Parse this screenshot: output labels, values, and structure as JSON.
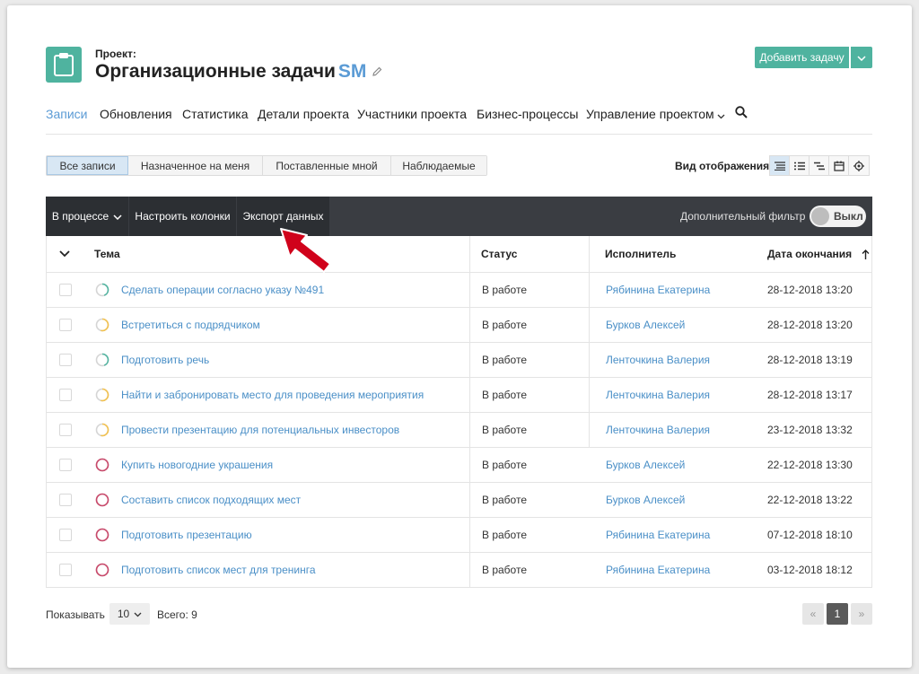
{
  "header": {
    "project_label": "Проект:",
    "project_title": "Организационные задачи",
    "project_abbr": "SM",
    "add_task_label": "Добавить задачу",
    "accent_color": "#4fb39f"
  },
  "nav": {
    "items": [
      {
        "label": "Записи",
        "active": true
      },
      {
        "label": "Обновления"
      },
      {
        "label": "Статистика"
      },
      {
        "label": "Детали проекта"
      },
      {
        "label": "Участники проекта"
      },
      {
        "label": "Бизнес-процессы"
      },
      {
        "label": "Управление проектом"
      }
    ],
    "search_icon": "search-icon"
  },
  "filters": {
    "tabs": [
      "Все записи",
      "Назначенное на меня",
      "Поставленные мной",
      "Наблюдаемые"
    ],
    "view_label": "Вид отображения:"
  },
  "toolbar": {
    "status_dropdown": "В процессе",
    "configure_columns": "Настроить колонки",
    "export_data": "Экспорт данных",
    "extra_filter": "Дополнительный фильтр",
    "toggle_label": "Выкл"
  },
  "table": {
    "columns": [
      "Тема",
      "Статус",
      "Исполнитель",
      "Дата окончания"
    ],
    "rows": [
      {
        "topic": "Сделать операции согласно указу №491",
        "status": "В работе",
        "assignee": "Рябинина Екатерина",
        "due": "28-12-2018 13:20",
        "ring": "green"
      },
      {
        "topic": "Встретиться с подрядчиком",
        "status": "В работе",
        "assignee": "Бурков Алексей",
        "due": "28-12-2018 13:20",
        "ring": "yellow"
      },
      {
        "topic": "Подготовить речь",
        "status": "В работе",
        "assignee": "Ленточкина Валерия",
        "due": "28-12-2018 13:19",
        "ring": "green"
      },
      {
        "topic": "Найти и забронировать место для проведения мероприятия",
        "status": "В работе",
        "assignee": "Ленточкина Валерия",
        "due": "28-12-2018 13:17",
        "ring": "yellow"
      },
      {
        "topic": "Провести презентацию для потенциальных инвесторов",
        "status": "В работе",
        "assignee": "Ленточкина Валерия",
        "due": "23-12-2018 13:32",
        "ring": "yellow"
      },
      {
        "topic": "Купить новогодние украшения",
        "status": "В работе",
        "assignee": "Бурков Алексей",
        "due": "22-12-2018 13:30",
        "ring": "red"
      },
      {
        "topic": "Составить список подходящих мест",
        "status": "В работе",
        "assignee": "Бурков Алексей",
        "due": "22-12-2018 13:22",
        "ring": "red"
      },
      {
        "topic": "Подготовить презентацию",
        "status": "В работе",
        "assignee": "Рябинина Екатерина",
        "due": "07-12-2018 18:10",
        "ring": "red"
      },
      {
        "topic": "Подготовить список мест для тренинга",
        "status": "В работе",
        "assignee": "Рябинина Екатерина",
        "due": "03-12-2018 18:12",
        "ring": "red"
      }
    ]
  },
  "footer": {
    "show_label": "Показывать",
    "page_size": "10",
    "total_label": "Всего: 9",
    "current_page": "1"
  },
  "colors": {
    "link": "#4a8fc7",
    "ring_green": "#4fb39f",
    "ring_yellow": "#f2c14e",
    "ring_red": "#c9486a",
    "arrow": "#d0021b"
  }
}
